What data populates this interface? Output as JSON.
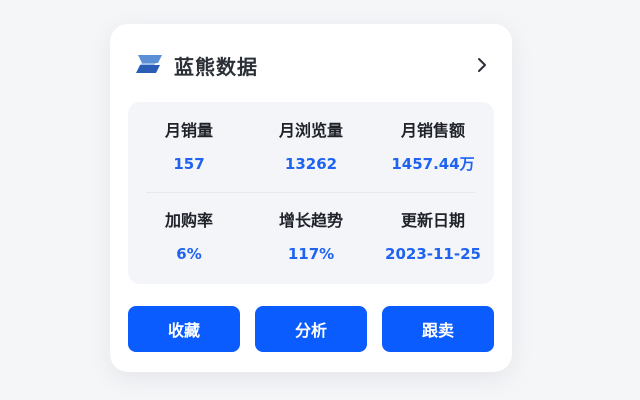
{
  "brand": {
    "name": "蓝熊数据",
    "logo_icon": "blue-bear-logo",
    "accent_color": "#1f63f0"
  },
  "header": {
    "more_icon": "chevron-right-icon"
  },
  "stats": [
    {
      "label": "月销量",
      "value": "157"
    },
    {
      "label": "月浏览量",
      "value": "13262"
    },
    {
      "label": "月销售额",
      "value": "1457.44万"
    },
    {
      "label": "加购率",
      "value": "6%"
    },
    {
      "label": "增长趋势",
      "value": "117%"
    },
    {
      "label": "更新日期",
      "value": "2023-11-25"
    }
  ],
  "actions": {
    "collect_label": "收藏",
    "analyze_label": "分析",
    "follow_sell_label": "跟卖",
    "button_color": "#0b5cff"
  }
}
